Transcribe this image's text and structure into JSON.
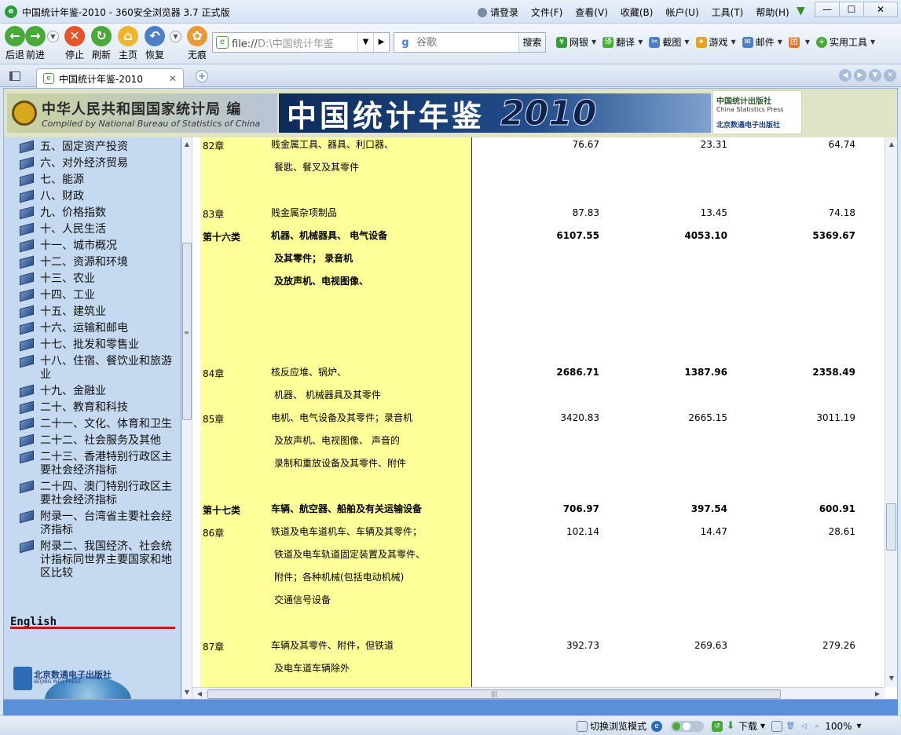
{
  "window": {
    "title": "中国统计年鉴-2010 - 360安全浏览器 3.7 正式版",
    "menu": [
      "请登录",
      "文件(F)",
      "查看(V)",
      "收藏(B)",
      "帐户(U)",
      "工具(T)",
      "帮助(H)"
    ],
    "controls": {
      "minimize": "—",
      "maximize": "☐",
      "close": "✕"
    }
  },
  "toolbar": {
    "back_label": "后退",
    "forward_label": "前进",
    "stop_label": "停止",
    "refresh_label": "刷新",
    "home_label": "主页",
    "restore_label": "恢复",
    "incognito_label": "无痕",
    "address": {
      "scheme": "file://",
      "path": "D:\\中国统计年鉴"
    },
    "search": {
      "engine": "g",
      "placeholder": "谷歌",
      "button": "搜索"
    },
    "plugins": [
      {
        "label": "网银",
        "color": "#3a9a3a",
        "icon": "bank-icon"
      },
      {
        "label": "翻译",
        "color": "#4aa93a",
        "icon": "translate-icon"
      },
      {
        "label": "截图",
        "color": "#4c7fc7",
        "icon": "screenshot-icon"
      },
      {
        "label": "游戏",
        "color": "#e6a12a",
        "icon": "game-icon"
      },
      {
        "label": "邮件",
        "color": "#4c7fc7",
        "icon": "mail-icon"
      },
      {
        "label": "",
        "color": "#e6752a",
        "icon": "app-icon"
      },
      {
        "label": "实用工具",
        "color": "#4aa93a",
        "icon": "tools-icon"
      }
    ]
  },
  "tabs": {
    "active": "中国统计年鉴-2010"
  },
  "banner": {
    "left_cn": "中华人民共和国国家统计局 编",
    "left_en": "Compiled by National Bureau of Statistics of China",
    "title": "中国统计年鉴",
    "year": "2010",
    "press_cn": "中国统计出版社",
    "press_en": "China Statistics Press",
    "press_info": "北京数通电子出版社"
  },
  "sidebar": {
    "items": [
      "五、固定资产投资",
      "六、对外经济贸易",
      "七、能源",
      "八、财政",
      "九、价格指数",
      "十、人民生活",
      "十一、城市概况",
      "十二、资源和环境",
      "十三、农业",
      "十四、工业",
      "十五、建筑业",
      "十六、运输和邮电",
      "十七、批发和零售业",
      "十八、住宿、餐饮业和旅游业",
      "十九、金融业",
      "二十、教育和科技",
      "二十一、文化、体育和卫生",
      "二十二、社会服务及其他",
      "二十三、香港特别行政区主要社会经济指标",
      "二十四、澳门特别行政区主要社会经济指标",
      "附录一、台湾省主要社会经济指标",
      "附录二、我国经济、社会统计指标同世界主要国家和地区比较"
    ],
    "english_link": "English",
    "logo_cn": "北京数通电子出版社",
    "logo_en": "BEIJING INFO PRESS"
  },
  "table": {
    "rows": [
      {
        "code": "82章",
        "desc": [
          "贱金属工具、器具、利口器、",
          "餐匙、餐叉及其零件"
        ],
        "v1": "76.67",
        "v2": "23.31",
        "v3": "64.74",
        "bold": false
      },
      {
        "code": "83章",
        "desc": [
          "贱金属杂项制品"
        ],
        "v1": "87.83",
        "v2": "13.45",
        "v3": "74.18",
        "bold": false
      },
      {
        "code": "第十六类",
        "desc": [
          "机器、机械器具、 电气设备",
          "及其零件； 录音机",
          "及放声机、电视图像、"
        ],
        "v1": "6107.55",
        "v2": "4053.10",
        "v3": "5369.67",
        "bold": true
      },
      {
        "code": "84章",
        "desc": [
          "核反应堆、锅炉、",
          "机器、 机械器具及其零件"
        ],
        "v1": "2686.71",
        "v2": "1387.96",
        "v3": "2358.49",
        "bold": false,
        "bold_values": true
      },
      {
        "code": "85章",
        "desc": [
          "电机、电气设备及其零件；录音机",
          "及放声机、电视图像、 声音的",
          "录制和重放设备及其零件、附件"
        ],
        "v1": "3420.83",
        "v2": "2665.15",
        "v3": "3011.19",
        "bold": false
      },
      {
        "code": "第十七类",
        "desc": [
          "车辆、航空器、船舶及有关运输设备"
        ],
        "v1": "706.97",
        "v2": "397.54",
        "v3": "600.91",
        "bold": true
      },
      {
        "code": "86章",
        "desc": [
          "铁道及电车道机车、车辆及其零件；",
          "铁道及电车轨道固定装置及其零件、",
          "附件；各种机械(包括电动机械)",
          "交通信号设备"
        ],
        "v1": "102.14",
        "v2": "14.47",
        "v3": "28.61",
        "bold": false
      },
      {
        "code": "87章",
        "desc": [
          "车辆及其零件、附件，但铁道",
          "及电车道车辆除外"
        ],
        "v1": "392.73",
        "v2": "269.63",
        "v3": "279.26",
        "bold": false
      }
    ]
  },
  "statusbar": {
    "mode_switch": "切换浏览模式",
    "download": "下载",
    "zoom": "100%"
  }
}
